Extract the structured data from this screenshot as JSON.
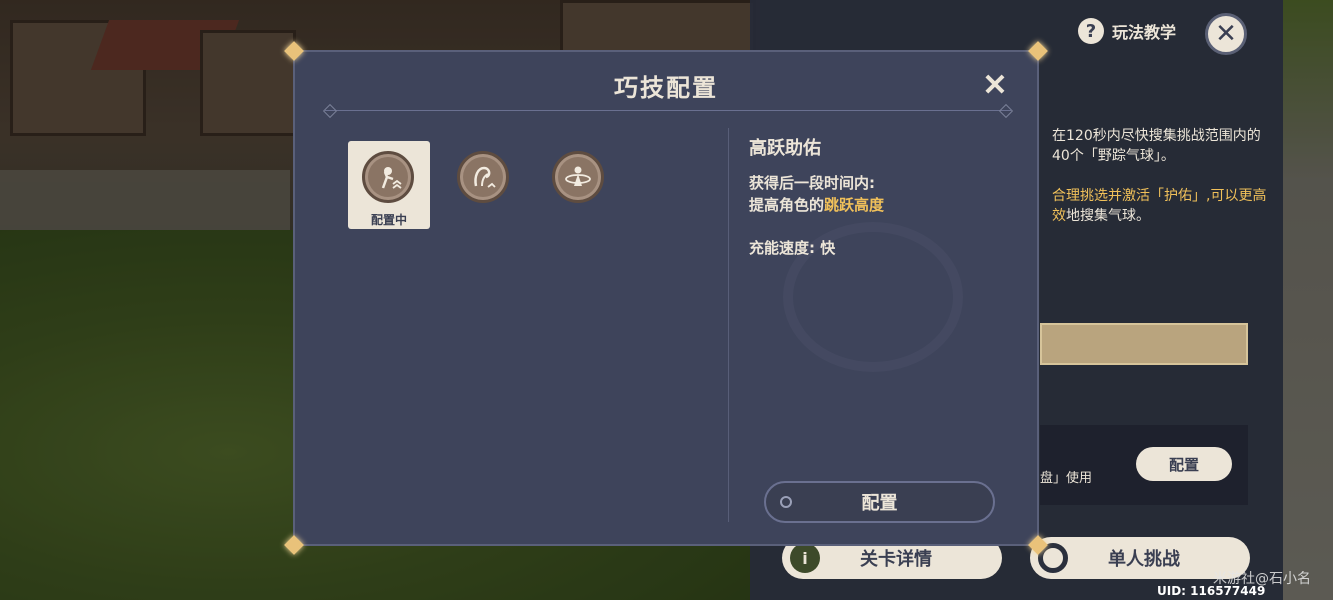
{
  "background": {
    "tutorial_label": "玩法教学",
    "description_line1": "在120秒内尽快搜集挑战范围内的40个「野踪气球」。",
    "description_line2_highlight": "合理挑选并激活「护佑」,可以更高效",
    "description_line2_rest": "地搜集气球。",
    "config_hint": "盘」使用",
    "config_button": "配置",
    "details_button": "关卡详情",
    "single_challenge_button": "单人挑战",
    "watermark": "米游社@石小名",
    "uid": "UID: 116577449"
  },
  "modal": {
    "title": "巧技配置",
    "skills": [
      {
        "icon": "jump-skill-icon",
        "status": "配置中",
        "selected": true
      },
      {
        "icon": "wind-skill-icon",
        "status": "",
        "selected": false
      },
      {
        "icon": "shield-skill-icon",
        "status": "",
        "selected": false
      }
    ],
    "detail": {
      "name": "高跃助佑",
      "line1": "获得后一段时间内:",
      "line2_prefix": "提高角色的",
      "line2_highlight": "跳跃高度",
      "charge_speed": "充能速度: 快"
    },
    "apply_button": "配置"
  },
  "colors": {
    "panel": "#3e445b",
    "accent_gold": "#f0c05a",
    "button_light": "#ece5d8"
  }
}
